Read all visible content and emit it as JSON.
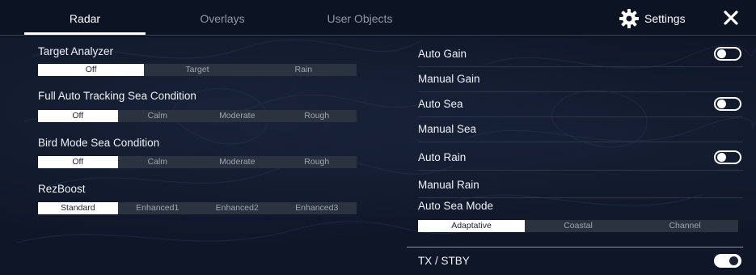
{
  "tabs": [
    {
      "label": "Radar",
      "active": true
    },
    {
      "label": "Overlays",
      "active": false
    },
    {
      "label": "User Objects",
      "active": false
    }
  ],
  "settings": {
    "label": "Settings",
    "icon": "gear-icon"
  },
  "close": {
    "icon": "close-icon"
  },
  "left": {
    "target_analyzer": {
      "title": "Target Analyzer",
      "options": [
        "Off",
        "Target",
        "Rain"
      ],
      "selected": "Off"
    },
    "full_auto_tracking": {
      "title": "Full Auto Tracking Sea Condition",
      "options": [
        "Off",
        "Calm",
        "Moderate",
        "Rough"
      ],
      "selected": "Off"
    },
    "bird_mode": {
      "title": "Bird Mode Sea Condition",
      "options": [
        "Off",
        "Calm",
        "Moderate",
        "Rough"
      ],
      "selected": "Off"
    },
    "rezboost": {
      "title": "RezBoost",
      "options": [
        "Standard",
        "Enhanced1",
        "Enhanced2",
        "Enhanced3"
      ],
      "selected": "Standard"
    }
  },
  "right": {
    "auto_gain": {
      "label": "Auto Gain",
      "on": false
    },
    "manual_gain": {
      "label": "Manual Gain"
    },
    "auto_sea": {
      "label": "Auto Sea",
      "on": false
    },
    "manual_sea": {
      "label": "Manual Sea"
    },
    "auto_rain": {
      "label": "Auto Rain",
      "on": false
    },
    "manual_rain": {
      "label": "Manual Rain"
    },
    "auto_sea_mode": {
      "label": "Auto Sea Mode",
      "options": [
        "Adaptative",
        "Coastal",
        "Channel"
      ],
      "selected": "Adaptative"
    },
    "tx_stby": {
      "label": "TX / STBY",
      "on": true
    }
  },
  "colors": {
    "background": "#0f1628",
    "selected": "#ffffff",
    "segment": "#2c3340",
    "text": "#eef2f7",
    "muted": "#9aa4b4"
  }
}
